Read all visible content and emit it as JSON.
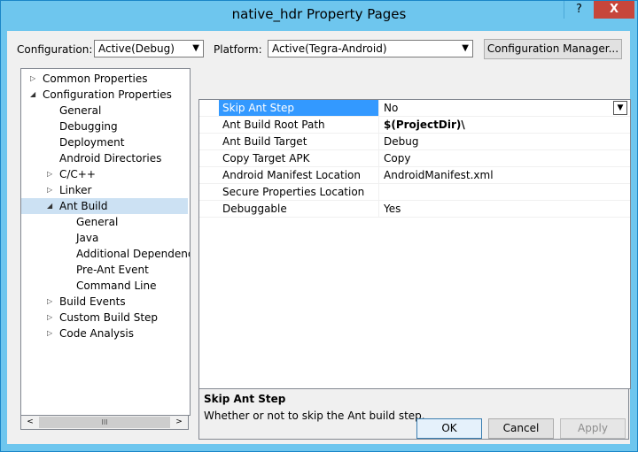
{
  "window": {
    "title": "native_hdr Property Pages",
    "help_label": "?",
    "close_label": "X"
  },
  "config": {
    "label": "Configuration:",
    "value": "Active(Debug)"
  },
  "platform": {
    "label": "Platform:",
    "value": "Active(Tegra-Android)"
  },
  "config_manager_label": "Configuration Manager...",
  "tree": [
    {
      "label": "Common Properties",
      "expander": "▷"
    },
    {
      "label": "Configuration Properties",
      "expander": "◢"
    },
    {
      "label": "General",
      "expander": ""
    },
    {
      "label": "Debugging",
      "expander": ""
    },
    {
      "label": "Deployment",
      "expander": ""
    },
    {
      "label": "Android Directories",
      "expander": ""
    },
    {
      "label": "C/C++",
      "expander": "▷"
    },
    {
      "label": "Linker",
      "expander": "▷"
    },
    {
      "label": "Ant Build",
      "expander": "◢"
    },
    {
      "label": "General",
      "expander": ""
    },
    {
      "label": "Java",
      "expander": ""
    },
    {
      "label": "Additional Dependencies",
      "expander": ""
    },
    {
      "label": "Pre-Ant Event",
      "expander": ""
    },
    {
      "label": "Command Line",
      "expander": ""
    },
    {
      "label": "Build Events",
      "expander": "▷"
    },
    {
      "label": "Custom Build Step",
      "expander": "▷"
    },
    {
      "label": "Code Analysis",
      "expander": "▷"
    }
  ],
  "scrollbar": {
    "left_arrow": "<",
    "right_arrow": ">",
    "grip": "III"
  },
  "properties": [
    {
      "name": "Skip Ant Step",
      "value": "No"
    },
    {
      "name": "Ant Build Root Path",
      "value": "$(ProjectDir)\\"
    },
    {
      "name": "Ant Build Target",
      "value": "Debug"
    },
    {
      "name": "Copy Target APK",
      "value": "Copy"
    },
    {
      "name": "Android Manifest Location",
      "value": "AndroidManifest.xml"
    },
    {
      "name": "Secure Properties Location",
      "value": ""
    },
    {
      "name": "Debuggable",
      "value": "Yes"
    }
  ],
  "description": {
    "title": "Skip Ant Step",
    "text": "Whether or not to skip the Ant build step."
  },
  "buttons": {
    "ok": "OK",
    "cancel": "Cancel",
    "apply": "Apply"
  },
  "colors": {
    "titlebar": "#6ec6ee",
    "close": "#c7463b",
    "selected_row": "#3399ff",
    "tree_selected": "#cce1f3"
  }
}
